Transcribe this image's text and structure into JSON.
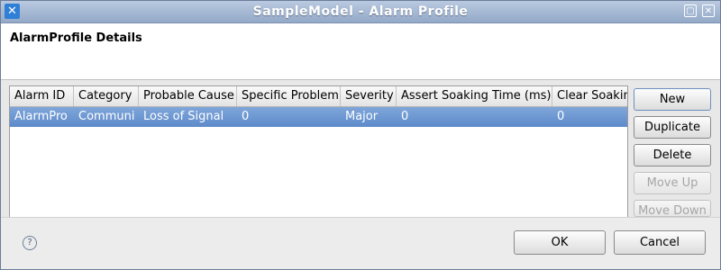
{
  "window": {
    "title": "SampleModel - Alarm Profile",
    "icons": {
      "app": "app-logo-icon",
      "maximize": "maximize-icon",
      "close": "close-icon"
    }
  },
  "header": {
    "title": "AlarmProfile Details"
  },
  "table": {
    "columns": [
      "Alarm ID",
      "Category",
      "Probable Cause",
      "Specific Problem",
      "Severity",
      "Assert Soaking Time (ms)",
      "Clear Soaking"
    ],
    "rows": [
      [
        "AlarmPro",
        "Communi",
        "Loss of Signal",
        "0",
        "Major",
        "0",
        "0"
      ]
    ],
    "selected_row": 0,
    "selection_color": "#6f98d2"
  },
  "side_buttons": {
    "new": "New",
    "duplicate": "Duplicate",
    "delete": "Delete",
    "move_up": "Move Up",
    "move_down": "Move Down"
  },
  "footer": {
    "help_icon": "help-icon",
    "ok": "OK",
    "cancel": "Cancel"
  }
}
